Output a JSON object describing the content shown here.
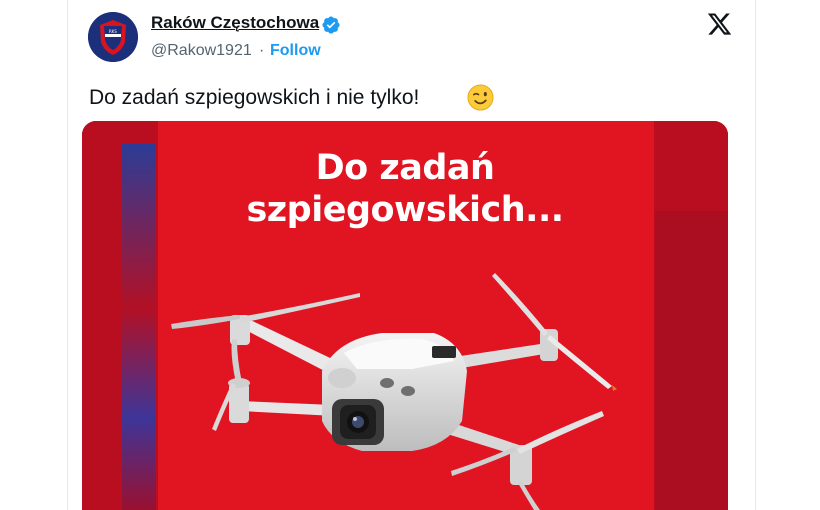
{
  "tweet": {
    "author_name": "Raków Częstochowa",
    "handle": "@Rakow1921",
    "separator": "·",
    "follow_label": "Follow",
    "text": "Do zadań szpiegowskich i nie tylko!",
    "emoji": "winking-face",
    "media": {
      "title_line1": "Do zadań",
      "title_line2": "szpiegowskich..."
    }
  },
  "icons": {
    "verified": "verified-badge-icon",
    "platform": "x-logo-icon"
  },
  "colors": {
    "brand_red": "#e51422",
    "brand_navy": "#1b2f7a",
    "link_blue": "#1d9bf0",
    "text": "#0f1419",
    "muted": "#536471"
  }
}
